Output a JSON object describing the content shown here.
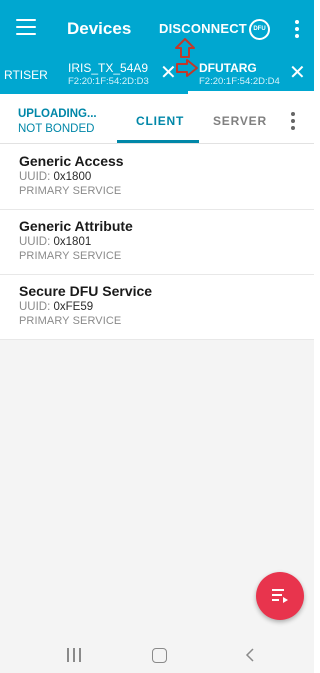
{
  "header": {
    "title": "Devices",
    "disconnect_label": "DISCONNECT",
    "dfu_badge": "DFU",
    "icons": [
      "hamburger-menu-icon",
      "dfu-icon",
      "more-vert-icon"
    ]
  },
  "device_tabs": [
    {
      "name": "RTISER",
      "mac": ""
    },
    {
      "name": "IRIS_TX_54A9",
      "mac": "F2:20:1F:54:2D:D3"
    },
    {
      "name": "DFUTARG",
      "mac": "F2:20:1F:54:2D:D4"
    }
  ],
  "connection": {
    "state": "UPLOADING...",
    "bond": "NOT BONDED"
  },
  "tabs": [
    {
      "label": "CLIENT"
    },
    {
      "label": "SERVER"
    }
  ],
  "services": [
    {
      "name": "Generic Access",
      "uuid_label": "UUID:",
      "uuid": "0x1800",
      "type": "PRIMARY SERVICE"
    },
    {
      "name": "Generic Attribute",
      "uuid_label": "UUID:",
      "uuid": "0x1801",
      "type": "PRIMARY SERVICE"
    },
    {
      "name": "Secure DFU Service",
      "uuid_label": "UUID:",
      "uuid": "0xFE59",
      "type": "PRIMARY SERVICE"
    }
  ],
  "colors": {
    "app_bar": "#00a7d0",
    "accent": "#0087a8",
    "fab": "#e8344d",
    "annotation_arrow": "#c0392b"
  }
}
